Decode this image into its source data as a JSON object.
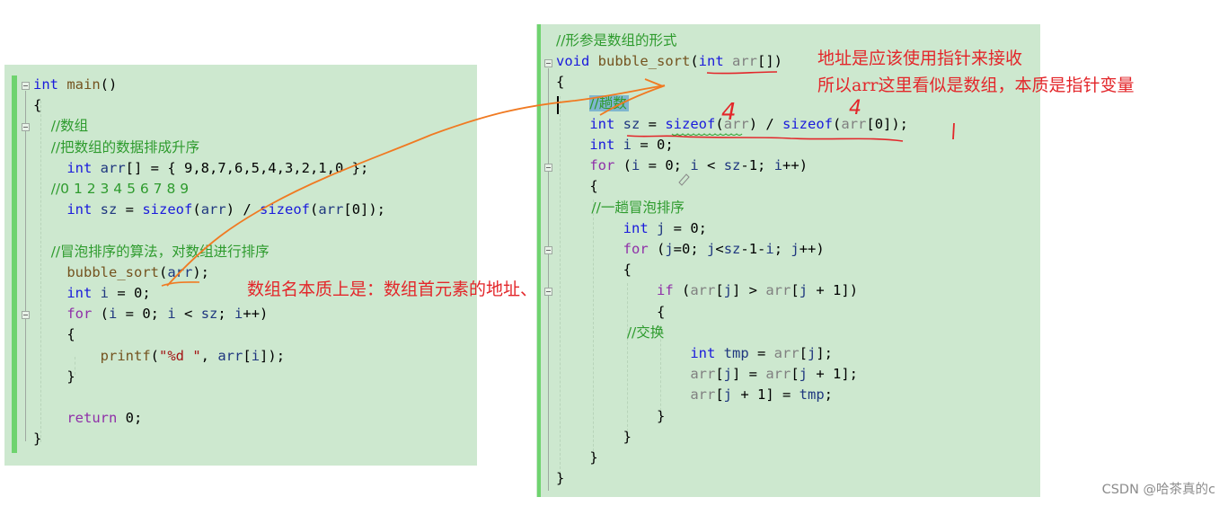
{
  "left_code": {
    "lines": [
      [
        {
          "t": "int",
          "c": "kw"
        },
        {
          "t": " ",
          "c": "plain"
        },
        {
          "t": "main",
          "c": "fn"
        },
        {
          "t": "()",
          "c": "plain"
        }
      ],
      [
        {
          "t": "{",
          "c": "plain"
        }
      ],
      [
        {
          "t": "    //数组",
          "c": "cm"
        }
      ],
      [
        {
          "t": "    //把数组的数据排成升序",
          "c": "cm"
        }
      ],
      [
        {
          "t": "    ",
          "c": "plain"
        },
        {
          "t": "int",
          "c": "kw"
        },
        {
          "t": " ",
          "c": "plain"
        },
        {
          "t": "arr",
          "c": "var"
        },
        {
          "t": "[] = { 9,8,7,6,5,4,3,2,1,0 };",
          "c": "plain"
        }
      ],
      [
        {
          "t": "    //0 1 2 3 4 5 6 7 8 9",
          "c": "cm"
        }
      ],
      [
        {
          "t": "    ",
          "c": "plain"
        },
        {
          "t": "int",
          "c": "kw"
        },
        {
          "t": " ",
          "c": "plain"
        },
        {
          "t": "sz",
          "c": "var"
        },
        {
          "t": " = ",
          "c": "plain"
        },
        {
          "t": "sizeof",
          "c": "kw"
        },
        {
          "t": "(",
          "c": "plain"
        },
        {
          "t": "arr",
          "c": "var"
        },
        {
          "t": ") / ",
          "c": "plain"
        },
        {
          "t": "sizeof",
          "c": "kw"
        },
        {
          "t": "(",
          "c": "plain"
        },
        {
          "t": "arr",
          "c": "var"
        },
        {
          "t": "[0]);",
          "c": "plain"
        }
      ],
      [
        {
          "t": "",
          "c": "plain"
        }
      ],
      [
        {
          "t": "    //冒泡排序的算法，对数组进行排序",
          "c": "cm"
        }
      ],
      [
        {
          "t": "    ",
          "c": "plain"
        },
        {
          "t": "bubble_sort",
          "c": "fn"
        },
        {
          "t": "(",
          "c": "plain"
        },
        {
          "t": "arr",
          "c": "var"
        },
        {
          "t": ");",
          "c": "plain"
        }
      ],
      [
        {
          "t": "    ",
          "c": "plain"
        },
        {
          "t": "int",
          "c": "kw"
        },
        {
          "t": " ",
          "c": "plain"
        },
        {
          "t": "i",
          "c": "var"
        },
        {
          "t": " = 0;",
          "c": "plain"
        }
      ],
      [
        {
          "t": "    ",
          "c": "plain"
        },
        {
          "t": "for",
          "c": "ctrl"
        },
        {
          "t": " (",
          "c": "plain"
        },
        {
          "t": "i",
          "c": "var"
        },
        {
          "t": " = 0; ",
          "c": "plain"
        },
        {
          "t": "i",
          "c": "var"
        },
        {
          "t": " < ",
          "c": "plain"
        },
        {
          "t": "sz",
          "c": "var"
        },
        {
          "t": "; ",
          "c": "plain"
        },
        {
          "t": "i",
          "c": "var"
        },
        {
          "t": "++)",
          "c": "plain"
        }
      ],
      [
        {
          "t": "    {",
          "c": "plain"
        }
      ],
      [
        {
          "t": "        ",
          "c": "plain"
        },
        {
          "t": "printf",
          "c": "fn"
        },
        {
          "t": "(",
          "c": "plain"
        },
        {
          "t": "\"%d \"",
          "c": "str"
        },
        {
          "t": ", ",
          "c": "plain"
        },
        {
          "t": "arr",
          "c": "var"
        },
        {
          "t": "[",
          "c": "plain"
        },
        {
          "t": "i",
          "c": "var"
        },
        {
          "t": "]);",
          "c": "plain"
        }
      ],
      [
        {
          "t": "    }",
          "c": "plain"
        }
      ],
      [
        {
          "t": "",
          "c": "plain"
        }
      ],
      [
        {
          "t": "    ",
          "c": "plain"
        },
        {
          "t": "return",
          "c": "ctrl"
        },
        {
          "t": " 0;",
          "c": "plain"
        }
      ],
      [
        {
          "t": "}",
          "c": "plain"
        }
      ]
    ]
  },
  "right_code": {
    "lines": [
      [
        {
          "t": "//形参是数组的形式",
          "c": "cm"
        }
      ],
      [
        {
          "t": "void",
          "c": "kw"
        },
        {
          "t": " ",
          "c": "plain"
        },
        {
          "t": "bubble_sort",
          "c": "fn"
        },
        {
          "t": "(",
          "c": "plain"
        },
        {
          "t": "int",
          "c": "kw"
        },
        {
          "t": " ",
          "c": "plain"
        },
        {
          "t": "arr",
          "c": "param"
        },
        {
          "t": "[])",
          "c": "plain"
        }
      ],
      [
        {
          "t": "{",
          "c": "plain"
        }
      ],
      [
        {
          "t": "    ",
          "c": "plain"
        },
        {
          "t": "//趟数",
          "c": "cm sel"
        }
      ],
      [
        {
          "t": "    ",
          "c": "plain"
        },
        {
          "t": "int",
          "c": "kw"
        },
        {
          "t": " ",
          "c": "plain"
        },
        {
          "t": "sz",
          "c": "var"
        },
        {
          "t": " = ",
          "c": "plain"
        },
        {
          "t": "sizeof",
          "c": "kw"
        },
        {
          "t": "(",
          "c": "plain"
        },
        {
          "t": "arr",
          "c": "param"
        },
        {
          "t": ") / ",
          "c": "plain"
        },
        {
          "t": "sizeof",
          "c": "kw"
        },
        {
          "t": "(",
          "c": "plain"
        },
        {
          "t": "arr",
          "c": "param"
        },
        {
          "t": "[0]);",
          "c": "plain"
        }
      ],
      [
        {
          "t": "    ",
          "c": "plain"
        },
        {
          "t": "int",
          "c": "kw"
        },
        {
          "t": " ",
          "c": "plain"
        },
        {
          "t": "i",
          "c": "var"
        },
        {
          "t": " = 0;",
          "c": "plain"
        }
      ],
      [
        {
          "t": "    ",
          "c": "plain"
        },
        {
          "t": "for",
          "c": "ctrl"
        },
        {
          "t": " (",
          "c": "plain"
        },
        {
          "t": "i",
          "c": "var"
        },
        {
          "t": " = 0; ",
          "c": "plain"
        },
        {
          "t": "i",
          "c": "var"
        },
        {
          "t": " < ",
          "c": "plain"
        },
        {
          "t": "sz",
          "c": "var"
        },
        {
          "t": "-1; ",
          "c": "plain"
        },
        {
          "t": "i",
          "c": "var"
        },
        {
          "t": "++)",
          "c": "plain"
        }
      ],
      [
        {
          "t": "    {",
          "c": "plain"
        }
      ],
      [
        {
          "t": "        //一趟冒泡排序",
          "c": "cm"
        }
      ],
      [
        {
          "t": "        ",
          "c": "plain"
        },
        {
          "t": "int",
          "c": "kw"
        },
        {
          "t": " ",
          "c": "plain"
        },
        {
          "t": "j",
          "c": "var"
        },
        {
          "t": " = 0;",
          "c": "plain"
        }
      ],
      [
        {
          "t": "        ",
          "c": "plain"
        },
        {
          "t": "for",
          "c": "ctrl"
        },
        {
          "t": " (",
          "c": "plain"
        },
        {
          "t": "j",
          "c": "var"
        },
        {
          "t": "=0; ",
          "c": "plain"
        },
        {
          "t": "j",
          "c": "var"
        },
        {
          "t": "<",
          "c": "plain"
        },
        {
          "t": "sz",
          "c": "var"
        },
        {
          "t": "-1-",
          "c": "plain"
        },
        {
          "t": "i",
          "c": "var"
        },
        {
          "t": "; ",
          "c": "plain"
        },
        {
          "t": "j",
          "c": "var"
        },
        {
          "t": "++)",
          "c": "plain"
        }
      ],
      [
        {
          "t": "        {",
          "c": "plain"
        }
      ],
      [
        {
          "t": "            ",
          "c": "plain"
        },
        {
          "t": "if",
          "c": "ctrl"
        },
        {
          "t": " (",
          "c": "plain"
        },
        {
          "t": "arr",
          "c": "param"
        },
        {
          "t": "[",
          "c": "plain"
        },
        {
          "t": "j",
          "c": "var"
        },
        {
          "t": "] > ",
          "c": "plain"
        },
        {
          "t": "arr",
          "c": "param"
        },
        {
          "t": "[",
          "c": "plain"
        },
        {
          "t": "j",
          "c": "var"
        },
        {
          "t": " + 1])",
          "c": "plain"
        }
      ],
      [
        {
          "t": "            {",
          "c": "plain"
        }
      ],
      [
        {
          "t": "                //交换",
          "c": "cm"
        }
      ],
      [
        {
          "t": "                ",
          "c": "plain"
        },
        {
          "t": "int",
          "c": "kw"
        },
        {
          "t": " ",
          "c": "plain"
        },
        {
          "t": "tmp",
          "c": "var"
        },
        {
          "t": " = ",
          "c": "plain"
        },
        {
          "t": "arr",
          "c": "param"
        },
        {
          "t": "[",
          "c": "plain"
        },
        {
          "t": "j",
          "c": "var"
        },
        {
          "t": "];",
          "c": "plain"
        }
      ],
      [
        {
          "t": "                ",
          "c": "plain"
        },
        {
          "t": "arr",
          "c": "param"
        },
        {
          "t": "[",
          "c": "plain"
        },
        {
          "t": "j",
          "c": "var"
        },
        {
          "t": "] = ",
          "c": "plain"
        },
        {
          "t": "arr",
          "c": "param"
        },
        {
          "t": "[",
          "c": "plain"
        },
        {
          "t": "j",
          "c": "var"
        },
        {
          "t": " + 1];",
          "c": "plain"
        }
      ],
      [
        {
          "t": "                ",
          "c": "plain"
        },
        {
          "t": "arr",
          "c": "param"
        },
        {
          "t": "[",
          "c": "plain"
        },
        {
          "t": "j",
          "c": "var"
        },
        {
          "t": " + 1] = ",
          "c": "plain"
        },
        {
          "t": "tmp",
          "c": "var"
        },
        {
          "t": ";",
          "c": "plain"
        }
      ],
      [
        {
          "t": "            }",
          "c": "plain"
        }
      ],
      [
        {
          "t": "        }",
          "c": "plain"
        }
      ],
      [
        {
          "t": "    }",
          "c": "plain"
        }
      ],
      [
        {
          "t": "}",
          "c": "plain"
        }
      ]
    ]
  },
  "annotations": {
    "array_name_note": "数组名本质上是：数组首元素的地址、",
    "pointer_note_line1": "地址是应该使用指针来接收",
    "pointer_note_line2": "所以arr这里看似是数组，本质是指针变量",
    "handwritten_size_1": "4",
    "handwritten_size_2": "4",
    "handwritten_result": "1"
  },
  "watermark": "CSDN @哈茶真的c",
  "colors": {
    "editor_bg": "#cde8cf",
    "change_bar": "#6fd36f",
    "annotation_red": "#e3262a",
    "arrow_orange": "#f07a22"
  }
}
